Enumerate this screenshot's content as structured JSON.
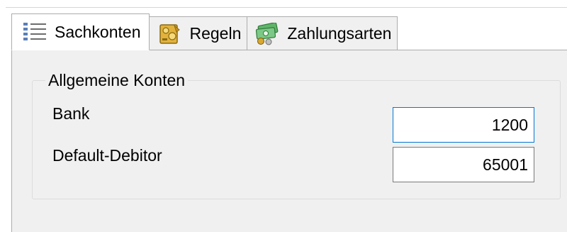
{
  "tabs": [
    {
      "label": "Sachkonten",
      "icon": "list-icon",
      "active": true
    },
    {
      "label": "Regeln",
      "icon": "rules-icon",
      "active": false
    },
    {
      "label": "Zahlungsarten",
      "icon": "payment-methods-icon",
      "active": false
    }
  ],
  "group": {
    "title": "Allgemeine Konten",
    "rows": [
      {
        "label": "Bank",
        "value": "1200"
      },
      {
        "label": "Default-Debitor",
        "value": "65001"
      }
    ]
  },
  "colors": {
    "focus_border": "#0078d7",
    "panel_background": "#f0f0f0"
  }
}
